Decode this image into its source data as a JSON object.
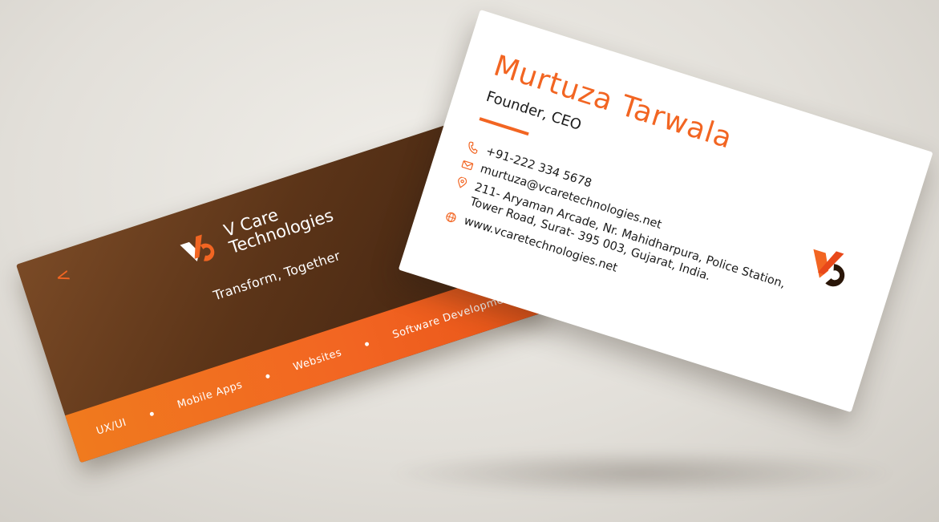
{
  "back_card": {
    "brand_line1": "V Care",
    "brand_line2": "Technologies",
    "tagline": "Transform, Together",
    "left_glyph": "<",
    "right_glyph": "|>",
    "services": [
      "UX/UI",
      "Mobile Apps",
      "Websites",
      "Software Development"
    ]
  },
  "front_card": {
    "name": "Murtuza Tarwala",
    "title": "Founder, CEO",
    "phone": "+91-222 334 5678",
    "email": "murtuza@vcaretechnologies.net",
    "address_line1": "211- Aryaman Arcade, Nr. Mahidharpura, Police Station,",
    "address_line2": "Tower Road, Surat- 395 003, Gujarat, India.",
    "website": "www.vcaretechnologies.net"
  },
  "colors": {
    "accent": "#f26522",
    "dark_card": "#5b3418",
    "logo_dark": "#2a1608"
  },
  "icons": [
    "phone-icon",
    "mail-icon",
    "location-pin-icon",
    "globe-icon",
    "v-care-logo-icon"
  ]
}
